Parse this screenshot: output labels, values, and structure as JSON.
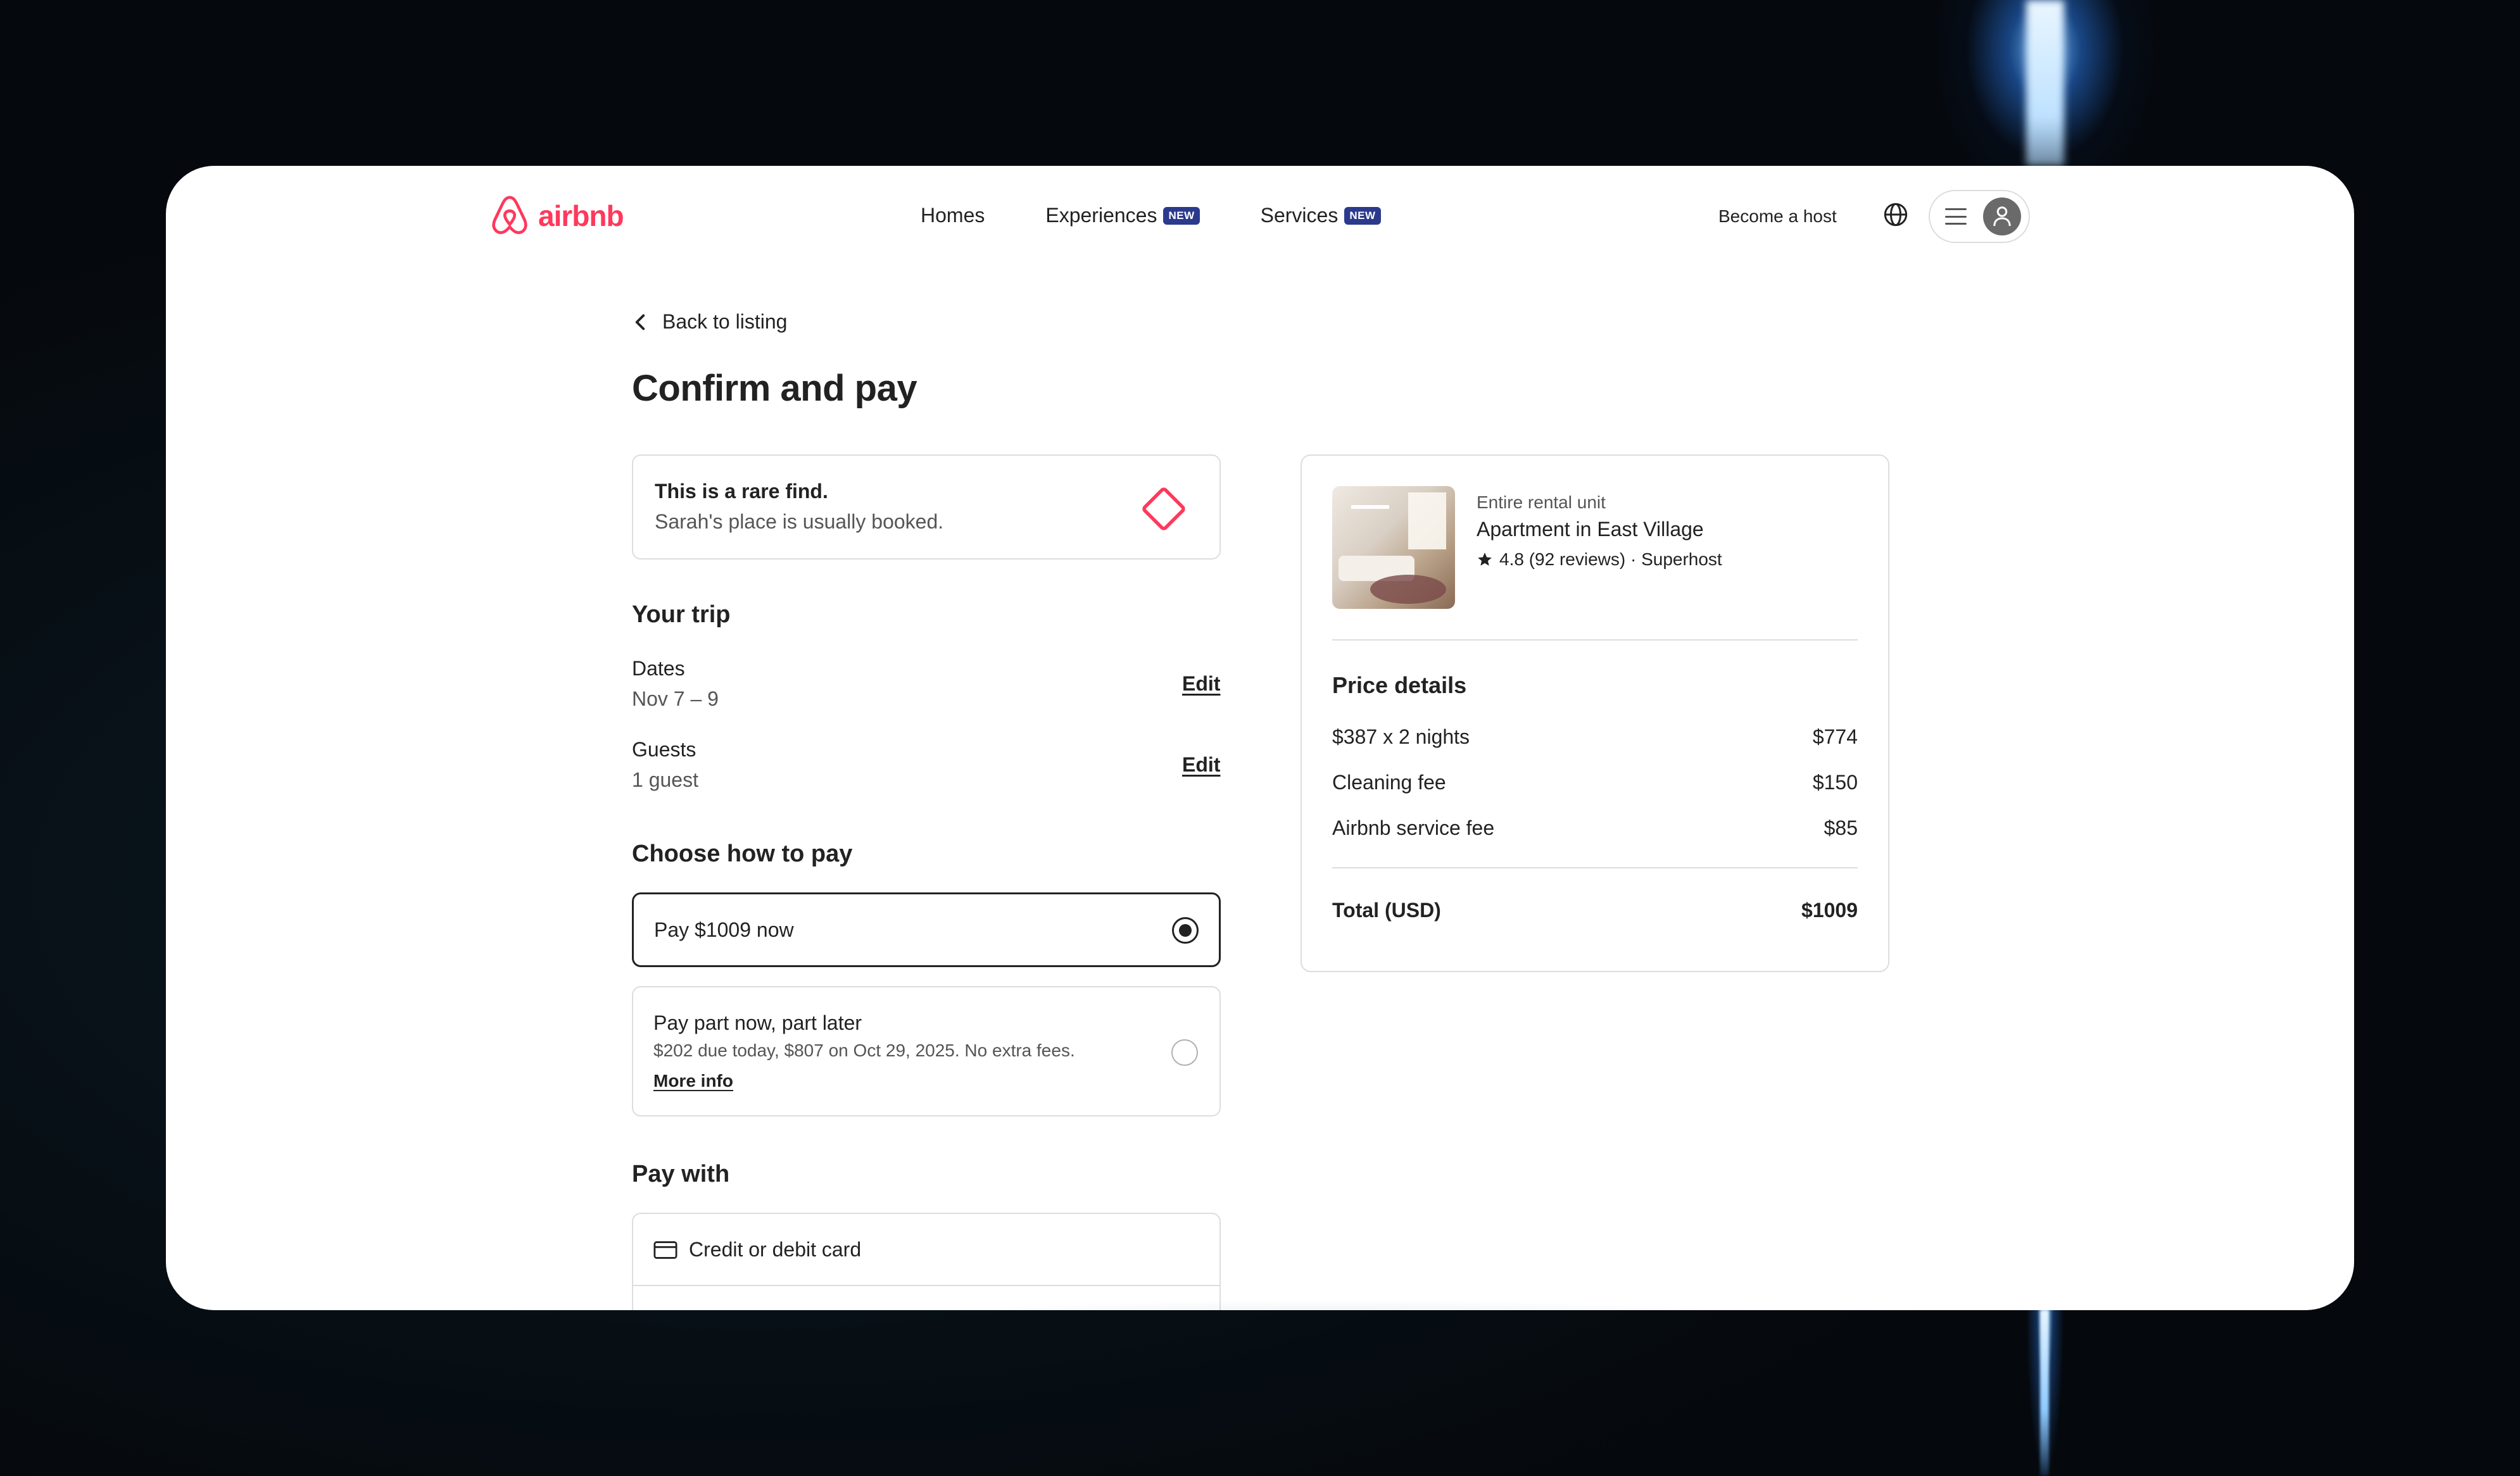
{
  "header": {
    "logo_text": "airbnb",
    "nav": [
      {
        "label": "Homes",
        "badge": ""
      },
      {
        "label": "Experiences",
        "badge": "NEW"
      },
      {
        "label": "Services",
        "badge": "NEW"
      }
    ],
    "become_host": "Become a host"
  },
  "page": {
    "back_label": "Back to listing",
    "title": "Confirm and pay"
  },
  "rare_find": {
    "title": "This is a rare find.",
    "subtitle": "Sarah's place is usually booked."
  },
  "trip": {
    "title": "Your trip",
    "dates_label": "Dates",
    "dates_value": "Nov 7 – 9",
    "guests_label": "Guests",
    "guests_value": "1 guest",
    "edit_label": "Edit"
  },
  "payment_choice": {
    "title": "Choose how to pay",
    "option_full": "Pay $1009 now",
    "option_partial": "Pay part now, part later",
    "option_partial_detail": "$202 due today, $807 on Oct 29, 2025. No extra fees.",
    "more_info": "More info",
    "selected": "full"
  },
  "pay_with": {
    "title": "Pay with",
    "method": "Credit or debit card"
  },
  "listing": {
    "type": "Entire rental unit",
    "name": "Apartment in East Village",
    "rating": "4.8 (92 reviews) · Superhost"
  },
  "price_details": {
    "title": "Price details",
    "rows": [
      {
        "label": "$387 x 2 nights",
        "amount": "$774"
      },
      {
        "label": "Cleaning fee",
        "amount": "$150"
      },
      {
        "label": "Airbnb service fee",
        "amount": "$85"
      }
    ],
    "total_label": "Total (USD)",
    "total_amount": "$1009"
  },
  "colors": {
    "brand": "#FF385C",
    "text": "#222222",
    "muted": "#555555",
    "border": "#dddddd",
    "badge": "#2b3a8c"
  },
  "icons": [
    "airbnb-logo-icon",
    "globe-icon",
    "hamburger-menu-icon",
    "user-avatar-icon",
    "chevron-left-icon",
    "diamond-icon",
    "star-icon",
    "credit-card-icon"
  ]
}
